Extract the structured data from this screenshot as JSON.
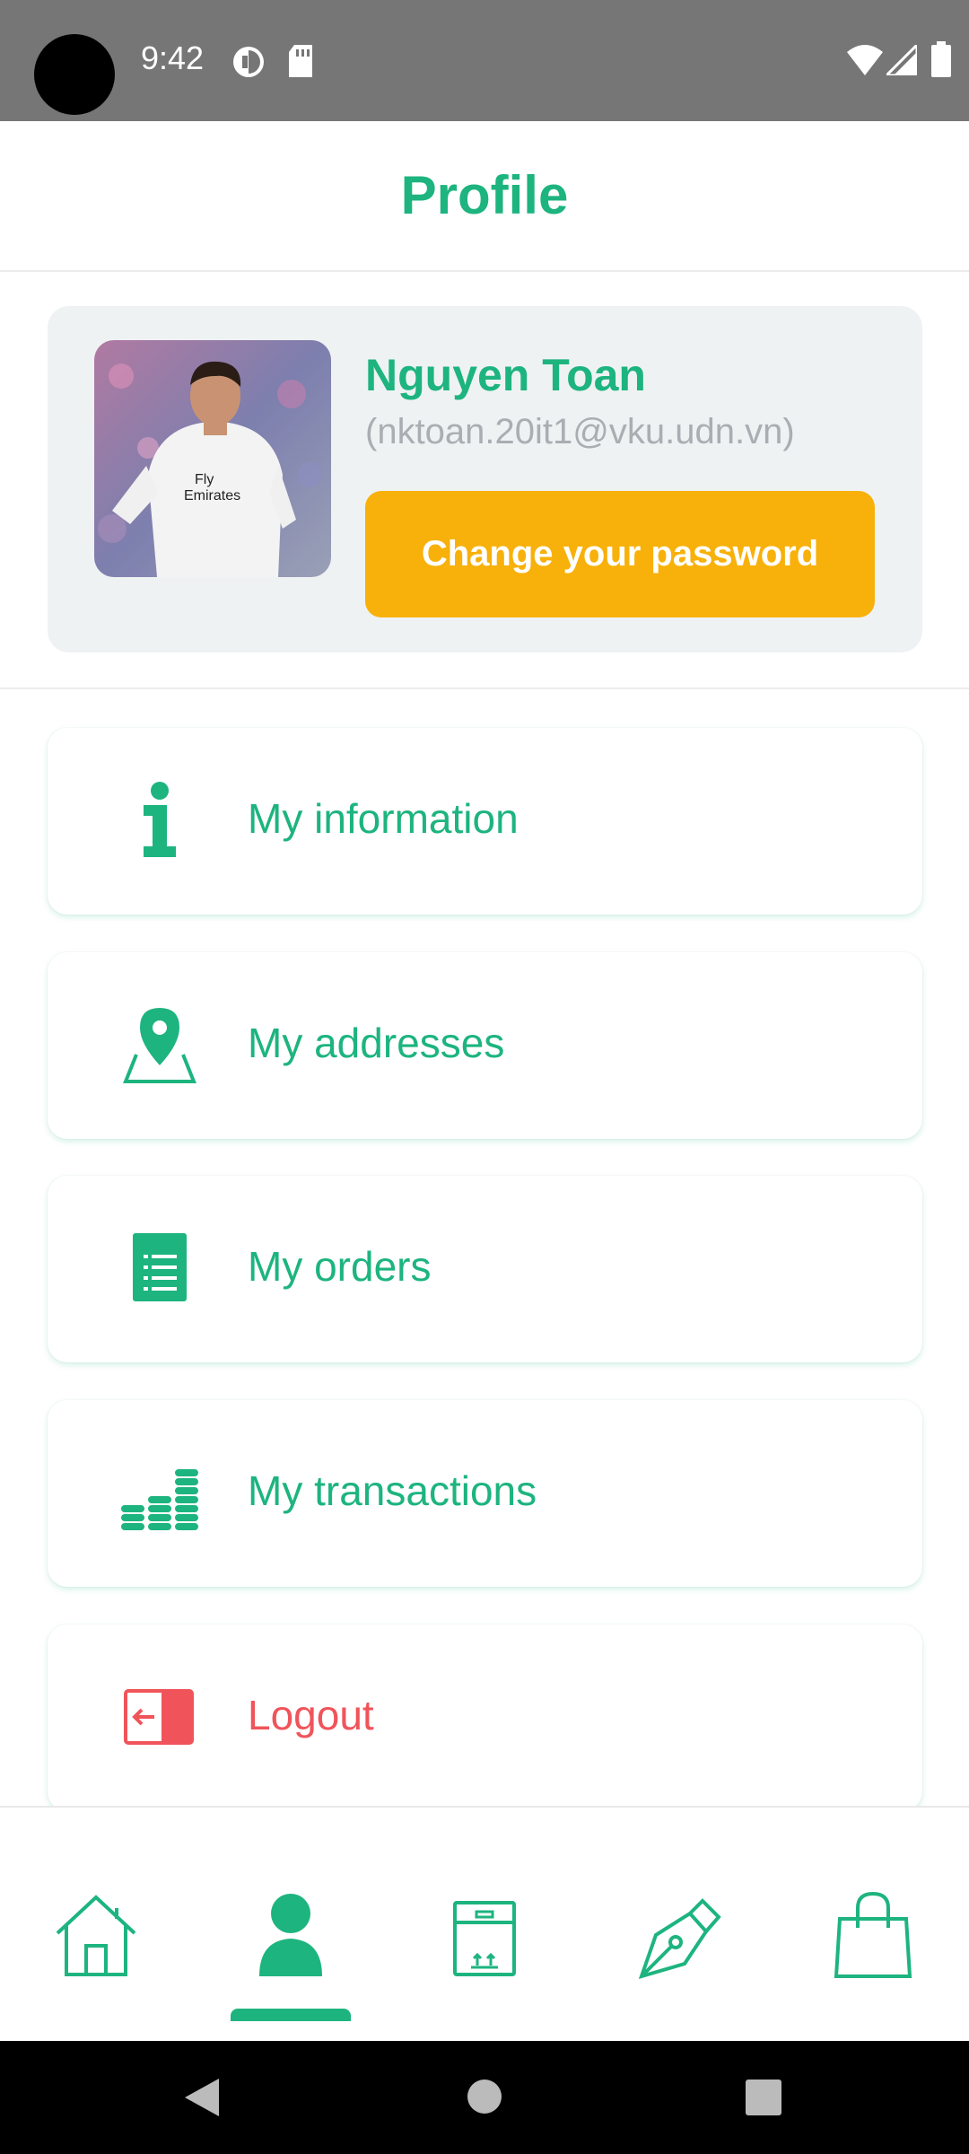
{
  "status_bar": {
    "time": "9:42"
  },
  "header": {
    "title": "Profile"
  },
  "profile": {
    "name": "Nguyen Toan",
    "email": "(nktoan.20it1@vku.udn.vn)",
    "change_password_label": "Change your password"
  },
  "menu": [
    {
      "label": "My information",
      "icon": "info-icon"
    },
    {
      "label": "My addresses",
      "icon": "map-pin-icon"
    },
    {
      "label": "My orders",
      "icon": "orders-list-icon"
    },
    {
      "label": "My transactions",
      "icon": "coins-icon"
    },
    {
      "label": "Logout",
      "icon": "logout-icon"
    }
  ],
  "bottom_nav": [
    {
      "name": "home",
      "icon": "home-icon",
      "active": false
    },
    {
      "name": "profile",
      "icon": "user-icon",
      "active": true
    },
    {
      "name": "orders",
      "icon": "box-icon",
      "active": false
    },
    {
      "name": "blog",
      "icon": "pen-icon",
      "active": false
    },
    {
      "name": "cart",
      "icon": "shopping-bag-icon",
      "active": false
    }
  ],
  "colors": {
    "accent": "#1db47f",
    "button": "#f8b10a",
    "danger": "#f0545a",
    "status_bar": "#767676"
  }
}
